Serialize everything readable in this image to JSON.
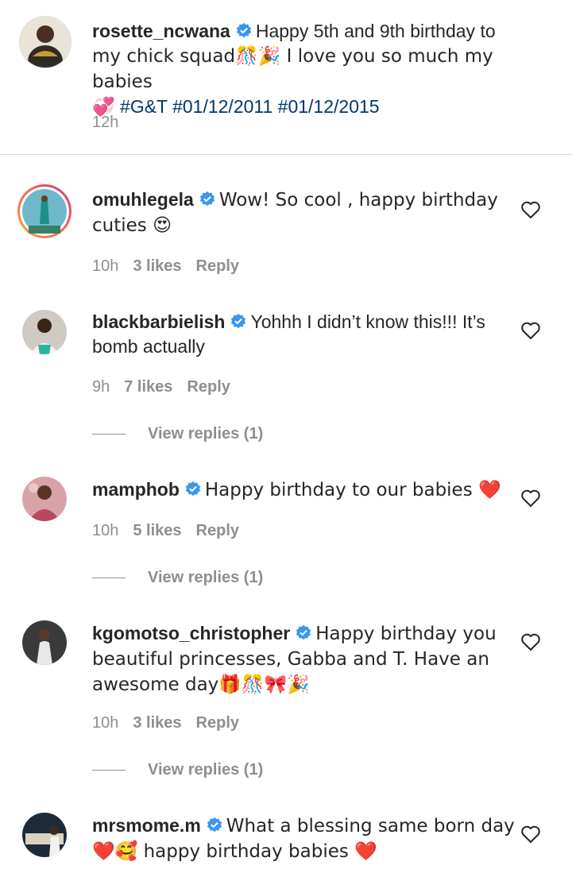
{
  "caption": {
    "username": "rosette_ncwana",
    "text_line1": "Happy 5th and 9th birthday to",
    "text_line2": "my chick squad🎊🎉 I love you so much my babies",
    "hearts_emoji": "💞",
    "tags": "#G&T #01/12/2011 #01/12/2015",
    "time": "12h"
  },
  "comments": [
    {
      "username": "omuhlegela",
      "text": "Wow! So cool , happy birthday cuties 😍",
      "time": "10h",
      "likes": "3 likes",
      "reply": "Reply"
    },
    {
      "username": "blackbarbielish",
      "text": "Yohhh I didn’t know this!!! It’s bomb actually",
      "time": "9h",
      "likes": "7 likes",
      "reply": "Reply",
      "view_replies": "View replies (1)"
    },
    {
      "username": "mamphob",
      "text": "Happy birthday to our babies ❤️",
      "time": "10h",
      "likes": "5 likes",
      "reply": "Reply",
      "view_replies": "View replies (1)"
    },
    {
      "username": "kgomotso_christopher",
      "text": "Happy birthday you beautiful princesses, Gabba and T. Have an awesome day🎁🎊🎀🎉",
      "time": "10h",
      "likes": "3 likes",
      "reply": "Reply",
      "view_replies": "View replies (1)"
    },
    {
      "username": "mrsmome.m",
      "text": "What a blessing same born day ❤️🥰 happy birthday babies ❤️"
    }
  ],
  "colors": {
    "verified": "#3897f0",
    "heart_outline": "#262626",
    "meta": "#8e8e8e"
  }
}
